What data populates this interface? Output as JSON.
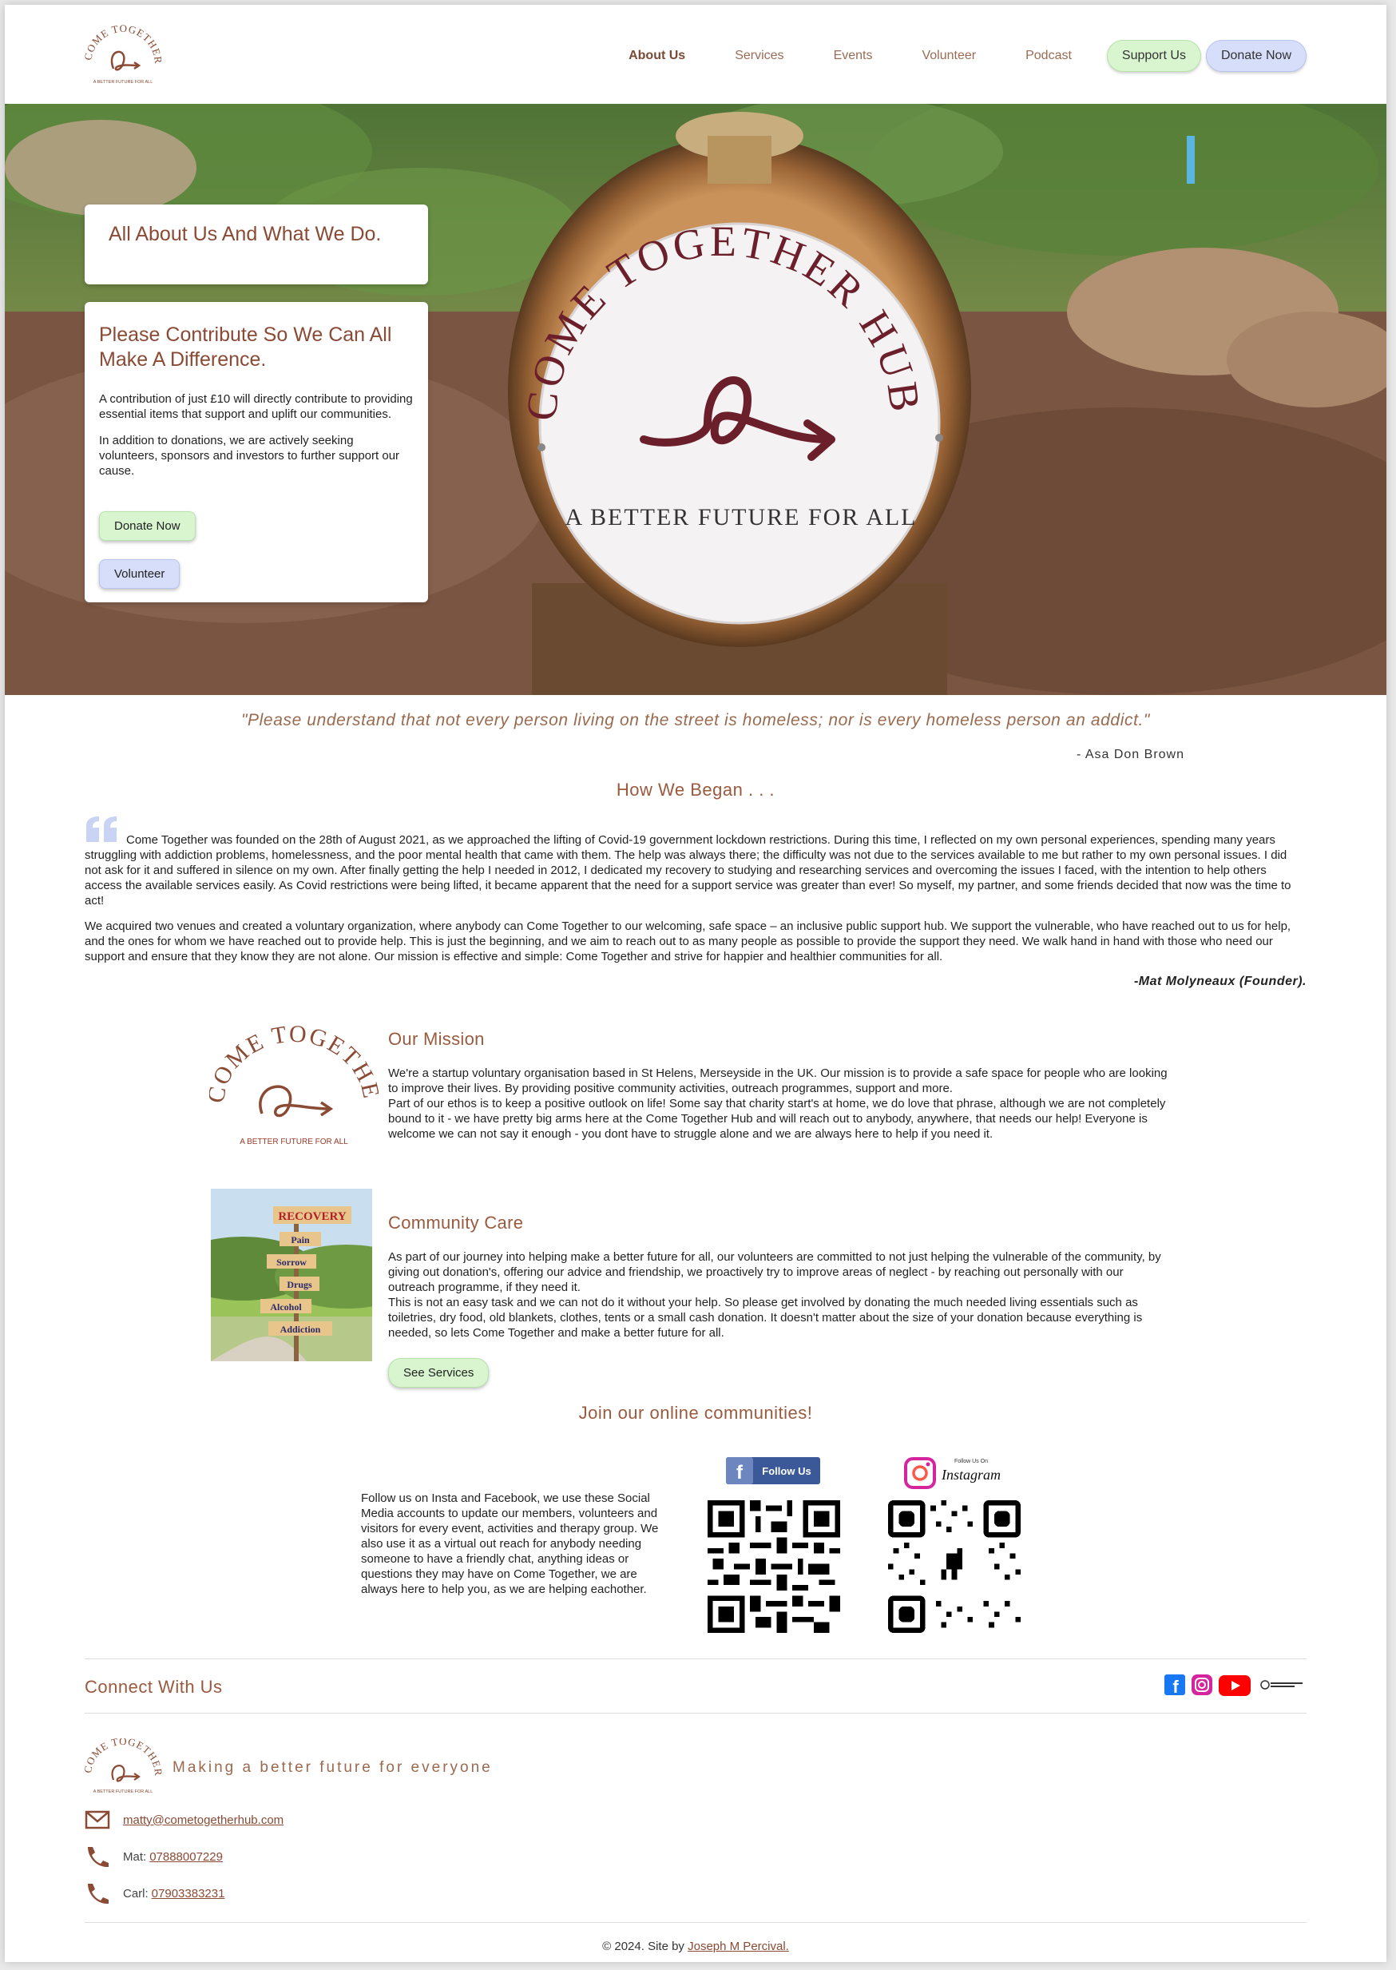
{
  "colors": {
    "accent": "#9a5a3e",
    "button_green": "#d8f5cf",
    "button_blue": "#d7defa",
    "logo_burgundy": "#7b1f2c"
  },
  "nav": {
    "logo_text": "COME TOGETHER",
    "logo_tagline": "A BETTER FUTURE FOR ALL",
    "links": [
      "About Us",
      "Services",
      "Events",
      "Volunteer",
      "Podcast"
    ],
    "support_label": "Support Us",
    "donate_label": "Donate Now"
  },
  "hero": {
    "sign_arc_text": "COME TOGETHER HUB",
    "sign_tagline": "A BETTER FUTURE FOR ALL",
    "card1_title": "All About Us And What We Do.",
    "card2_title": "Please Contribute So We Can All Make A Difference.",
    "card2_p1": "A contribution of just £10 will directly contribute to providing essential items that support and uplift our communities.",
    "card2_p2": "In addition to donations, we are actively seeking volunteers, sponsors and investors to further support our cause.",
    "donate_label": "Donate Now",
    "volunteer_label": "Volunteer"
  },
  "quote": {
    "text": "\"Please understand that not every person living on the street is homeless; nor is every homeless person an addict.\"",
    "author": "- Asa Don Brown"
  },
  "began": {
    "title": "How We Began . . .",
    "p1": "Come Together was founded on the 28th of August 2021, as we approached the lifting of Covid-19 government lockdown restrictions. During this time, I reflected on my own personal experiences, spending many years struggling with addiction problems, homelessness, and the poor mental health that came with them. The help was always there; the difficulty was not due to the services available to me but rather to my own personal issues. I did not ask for it and suffered in silence on my own. After finally getting the help I needed in 2012, I dedicated my recovery to studying and researching services and overcoming the issues I faced, with the intention to help others access the available services easily. As Covid restrictions were being lifted, it became apparent that the need for a support service was greater than ever! So myself, my partner, and some friends decided that now was the time to act!",
    "p2": "We acquired two venues and created a voluntary organization, where anybody can Come Together to our welcoming, safe space – an inclusive public support hub. We support the vulnerable, who have reached out to us for help, and the ones for whom we have reached out to provide help. This is just the beginning, and we aim to reach out to as many people as possible to provide the support they need. We walk hand in hand with those who need our support and ensure that they know they are not alone. Our mission is effective and simple: Come Together and strive for happier and healthier communities for all.",
    "founder": "-Mat Molyneaux (Founder)."
  },
  "mission": {
    "logo_text": "COME TOGETHER",
    "logo_tagline": "A BETTER FUTURE FOR ALL",
    "title": "Our Mission",
    "p1": "We're a startup voluntary organisation based in St Helens, Merseyside in the UK. Our mission is to provide a safe space for people who are looking to improve their lives. By providing positive community activities, outreach programmes, support and more.",
    "p2": "Part of our ethos is to keep a positive outlook on life! Some say that charity start's at home, we do love that phrase, although we are not completely bound to it - we have pretty big arms here at the Come Together Hub and will reach out to anybody, anywhere, that needs our help! Everyone is welcome we can not say it enough - you dont have to struggle alone and we are always here to help if you need it."
  },
  "care": {
    "title": "Community Care",
    "signs": [
      "RECOVERY",
      "Pain",
      "Sorrow",
      "Drugs",
      "Alcohol",
      "Addiction"
    ],
    "p1": "As part of our journey into helping make a better future for all, our volunteers are committed to not just helping the vulnerable of the community, by giving out donation's, offering our advice and friendship, we proactively try to improve areas of neglect - by reaching out personally with our outreach programme, if they need it.",
    "p2": "This is not an easy task and we can not do it without your help. So please get involved by donating the much needed living essentials such as toiletries, dry food, old blankets, clothes, tents or a small cash donation. It doesn't matter about the size of your donation because everything is needed, so lets Come Together and make a better future for all.",
    "services_label": "See Services"
  },
  "join": {
    "title": "Join our online communities!",
    "text": "Follow us on Insta and Facebook, we use these Social Media accounts to update our members, volunteers and visitors for every event, activities and therapy group. We also use it as a virtual out reach for anybody needing someone to have a friendly chat, anything ideas or questions they may have on Come Together, we are always here to help you, as we are helping eachother.",
    "fb_label": "Follow Us",
    "insta_small": "Follow Us On",
    "insta_label": "Instagram"
  },
  "footer": {
    "connect_title": "Connect With Us",
    "logo_text": "COME TOGETHER",
    "logo_tagline": "A BETTER FUTURE FOR ALL",
    "tagline": "Making a better future for everyone",
    "email": "matty@cometogetherhub.com",
    "phone1_label": "Mat:",
    "phone1": "07888007229",
    "phone2_label": "Carl:",
    "phone2": "07903383231",
    "copyright_prefix": "© 2024. Site by",
    "credit": "Joseph M Percival."
  }
}
